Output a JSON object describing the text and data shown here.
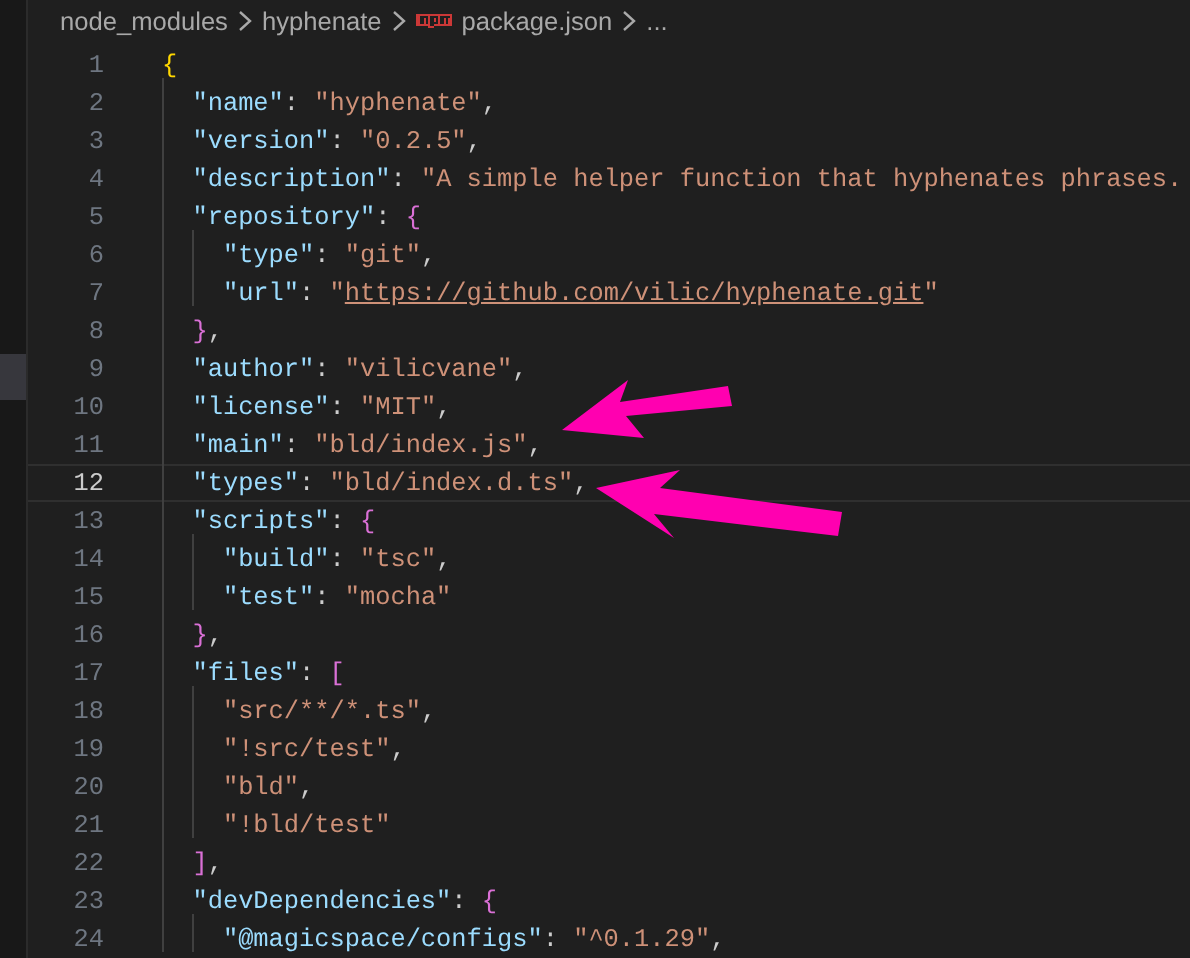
{
  "breadcrumb": [
    {
      "label": "node_modules",
      "kind": "folder"
    },
    {
      "label": "hyphenate",
      "kind": "folder"
    },
    {
      "label": "package.json",
      "kind": "npm-file"
    },
    {
      "label": "...",
      "kind": "more"
    }
  ],
  "lines": [
    {
      "number": "1",
      "current": false,
      "tokens": [
        {
          "kind": "brace1",
          "text": "{"
        }
      ]
    },
    {
      "number": "2",
      "current": false,
      "tokens": [
        {
          "kind": "key",
          "text": "  \"name\""
        },
        {
          "kind": "punct",
          "text": ": "
        },
        {
          "kind": "string",
          "text": "\"hyphenate\""
        },
        {
          "kind": "punct",
          "text": ","
        }
      ]
    },
    {
      "number": "3",
      "current": false,
      "tokens": [
        {
          "kind": "key",
          "text": "  \"version\""
        },
        {
          "kind": "punct",
          "text": ": "
        },
        {
          "kind": "string",
          "text": "\"0.2.5\""
        },
        {
          "kind": "punct",
          "text": ","
        }
      ]
    },
    {
      "number": "4",
      "current": false,
      "tokens": [
        {
          "kind": "key",
          "text": "  \"description\""
        },
        {
          "kind": "punct",
          "text": ": "
        },
        {
          "kind": "string",
          "text": "\"A simple helper function that hyphenates phrases."
        }
      ]
    },
    {
      "number": "5",
      "current": false,
      "tokens": [
        {
          "kind": "key",
          "text": "  \"repository\""
        },
        {
          "kind": "punct",
          "text": ": "
        },
        {
          "kind": "brace2",
          "text": "{"
        }
      ]
    },
    {
      "number": "6",
      "current": false,
      "tokens": [
        {
          "kind": "key",
          "text": "    \"type\""
        },
        {
          "kind": "punct",
          "text": ": "
        },
        {
          "kind": "string",
          "text": "\"git\""
        },
        {
          "kind": "punct",
          "text": ","
        }
      ]
    },
    {
      "number": "7",
      "current": false,
      "tokens": [
        {
          "kind": "key",
          "text": "    \"url\""
        },
        {
          "kind": "punct",
          "text": ": "
        },
        {
          "kind": "string",
          "text": "\""
        },
        {
          "kind": "link",
          "text": "https://github.com/vilic/hyphenate.git"
        },
        {
          "kind": "string",
          "text": "\""
        }
      ]
    },
    {
      "number": "8",
      "current": false,
      "tokens": [
        {
          "kind": "brace2",
          "text": "  }"
        },
        {
          "kind": "punct",
          "text": ","
        }
      ]
    },
    {
      "number": "9",
      "current": false,
      "tokens": [
        {
          "kind": "key",
          "text": "  \"author\""
        },
        {
          "kind": "punct",
          "text": ": "
        },
        {
          "kind": "string",
          "text": "\"vilicvane\""
        },
        {
          "kind": "punct",
          "text": ","
        }
      ]
    },
    {
      "number": "10",
      "current": false,
      "tokens": [
        {
          "kind": "key",
          "text": "  \"license\""
        },
        {
          "kind": "punct",
          "text": ": "
        },
        {
          "kind": "string",
          "text": "\"MIT\""
        },
        {
          "kind": "punct",
          "text": ","
        }
      ]
    },
    {
      "number": "11",
      "current": false,
      "tokens": [
        {
          "kind": "key",
          "text": "  \"main\""
        },
        {
          "kind": "punct",
          "text": ": "
        },
        {
          "kind": "string",
          "text": "\"bld/index.js\""
        },
        {
          "kind": "punct",
          "text": ","
        }
      ]
    },
    {
      "number": "12",
      "current": true,
      "tokens": [
        {
          "kind": "key",
          "text": "  \"types\""
        },
        {
          "kind": "punct",
          "text": ": "
        },
        {
          "kind": "string",
          "text": "\"bld/index.d.ts\""
        },
        {
          "kind": "punct",
          "text": ","
        }
      ]
    },
    {
      "number": "13",
      "current": false,
      "tokens": [
        {
          "kind": "key",
          "text": "  \"scripts\""
        },
        {
          "kind": "punct",
          "text": ": "
        },
        {
          "kind": "brace2",
          "text": "{"
        }
      ]
    },
    {
      "number": "14",
      "current": false,
      "tokens": [
        {
          "kind": "key",
          "text": "    \"build\""
        },
        {
          "kind": "punct",
          "text": ": "
        },
        {
          "kind": "string",
          "text": "\"tsc\""
        },
        {
          "kind": "punct",
          "text": ","
        }
      ]
    },
    {
      "number": "15",
      "current": false,
      "tokens": [
        {
          "kind": "key",
          "text": "    \"test\""
        },
        {
          "kind": "punct",
          "text": ": "
        },
        {
          "kind": "string",
          "text": "\"mocha\""
        }
      ]
    },
    {
      "number": "16",
      "current": false,
      "tokens": [
        {
          "kind": "brace2",
          "text": "  }"
        },
        {
          "kind": "punct",
          "text": ","
        }
      ]
    },
    {
      "number": "17",
      "current": false,
      "tokens": [
        {
          "kind": "key",
          "text": "  \"files\""
        },
        {
          "kind": "punct",
          "text": ": "
        },
        {
          "kind": "brace2",
          "text": "["
        }
      ]
    },
    {
      "number": "18",
      "current": false,
      "tokens": [
        {
          "kind": "string",
          "text": "    \"src/**/*.ts\""
        },
        {
          "kind": "punct",
          "text": ","
        }
      ]
    },
    {
      "number": "19",
      "current": false,
      "tokens": [
        {
          "kind": "string",
          "text": "    \"!src/test\""
        },
        {
          "kind": "punct",
          "text": ","
        }
      ]
    },
    {
      "number": "20",
      "current": false,
      "tokens": [
        {
          "kind": "string",
          "text": "    \"bld\""
        },
        {
          "kind": "punct",
          "text": ","
        }
      ]
    },
    {
      "number": "21",
      "current": false,
      "tokens": [
        {
          "kind": "string",
          "text": "    \"!bld/test\""
        }
      ]
    },
    {
      "number": "22",
      "current": false,
      "tokens": [
        {
          "kind": "brace2",
          "text": "  ]"
        },
        {
          "kind": "punct",
          "text": ","
        }
      ]
    },
    {
      "number": "23",
      "current": false,
      "tokens": [
        {
          "kind": "key",
          "text": "  \"devDependencies\""
        },
        {
          "kind": "punct",
          "text": ": "
        },
        {
          "kind": "brace2",
          "text": "{"
        }
      ]
    },
    {
      "number": "24",
      "current": false,
      "tokens": [
        {
          "kind": "key",
          "text": "    \"@magicspace/configs\""
        },
        {
          "kind": "punct",
          "text": ": "
        },
        {
          "kind": "string",
          "text": "\"^0.1.29\""
        },
        {
          "kind": "punct",
          "text": ","
        }
      ]
    }
  ]
}
